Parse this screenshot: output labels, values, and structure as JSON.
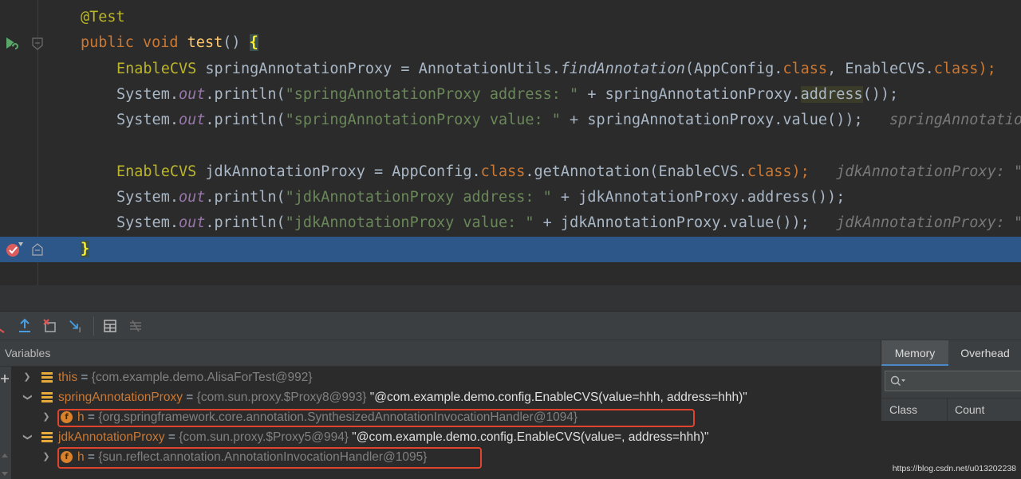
{
  "editor": {
    "line1": {
      "annotation": "@Test"
    },
    "line2": {
      "kw_public": "public",
      "kw_void": "void",
      "method": "test",
      "rest": "() ",
      "brace": "{"
    },
    "line3": {
      "type": "EnableCVS",
      "var": " springAnnotationProxy = AnnotationUtils.",
      "method": "findAnnotation",
      "args1": "(AppConfig.",
      "kw_class1": "class",
      "args2": ", EnableCVS.",
      "kw_class2": "class",
      "end": ");"
    },
    "line4": {
      "pre": "System.",
      "out": "out",
      "call": ".println(",
      "str": "\"springAnnotationProxy address: \"",
      "plus": " + springAnnotationProxy.",
      "hl": "address",
      "end": "());"
    },
    "line5": {
      "pre": "System.",
      "out": "out",
      "call": ".println(",
      "str": "\"springAnnotationProxy value: \"",
      "plus": " + springAnnotationProxy.value());",
      "hint": "   springAnnotatio"
    },
    "line7": {
      "type": "EnableCVS",
      "var": " jdkAnnotationProxy = AppConfig.",
      "kw_class1": "class",
      "call": ".getAnnotation(EnableCVS.",
      "kw_class2": "class",
      "end": ");",
      "hint": "   jdkAnnotationProxy: \""
    },
    "line8": {
      "pre": "System.",
      "out": "out",
      "call": ".println(",
      "str": "\"jdkAnnotationProxy address: \"",
      "plus": " + jdkAnnotationProxy.address());"
    },
    "line9": {
      "pre": "System.",
      "out": "out",
      "call": ".println(",
      "str": "\"jdkAnnotationProxy value: \"",
      "plus": " + jdkAnnotationProxy.value());",
      "hint": "   jdkAnnotationProxy: \""
    },
    "line10": {
      "brace": "}"
    }
  },
  "debugger": {
    "variables_title": "Variables",
    "rows": [
      {
        "name": "this",
        "eq": " = ",
        "type": "{com.example.demo.AlisaForTest@992}",
        "str": ""
      },
      {
        "name": "springAnnotationProxy",
        "eq": " = ",
        "type": "{com.sun.proxy.$Proxy8@993}",
        "str": " \"@com.example.demo.config.EnableCVS(value=hhh, address=hhh)\""
      },
      {
        "name": "h",
        "eq": " = ",
        "type": "{org.springframework.core.annotation.SynthesizedAnnotationInvocationHandler@1094}",
        "str": ""
      },
      {
        "name": "jdkAnnotationProxy",
        "eq": " = ",
        "type": "{com.sun.proxy.$Proxy5@994}",
        "str": " \"@com.example.demo.config.EnableCVS(value=, address=hhh)\""
      },
      {
        "name": "h",
        "eq": " = ",
        "type": "{sun.reflect.annotation.AnnotationInvocationHandler@1095}",
        "str": ""
      }
    ],
    "field_badge": "f"
  },
  "memory": {
    "tab_memory": "Memory",
    "tab_overhead": "Overhead",
    "col_class": "Class",
    "col_count": "Count"
  },
  "watermark": "https://blog.csdn.net/u013202238",
  "colors": {
    "keyword": "#cc7832",
    "string": "#6a8759",
    "method": "#ffc66d",
    "field": "#9876aa",
    "annotation": "#bbb529",
    "current_line": "#2d5689",
    "highlight_box": "#e0442e"
  }
}
